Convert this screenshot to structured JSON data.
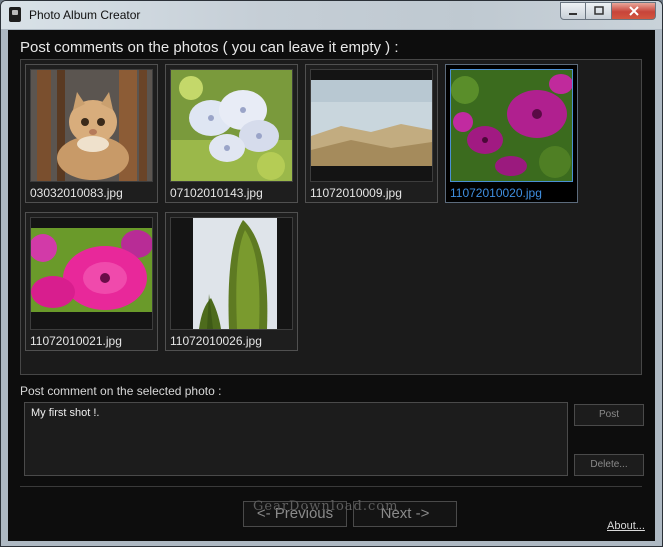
{
  "window": {
    "title": "Photo Album Creator",
    "icon": "camera-icon",
    "controls": {
      "minimize": "minimize-icon",
      "maximize": "maximize-icon",
      "close": "close-icon"
    }
  },
  "header": "Post comments on the photos ( you can leave it empty ) :",
  "photos": [
    {
      "filename": "03032010083.jpg",
      "thumbnail": "kitten",
      "selected": false
    },
    {
      "filename": "07102010143.jpg",
      "thumbnail": "white-flowers",
      "selected": false
    },
    {
      "filename": "11072010009.jpg",
      "thumbnail": "landscape",
      "selected": false
    },
    {
      "filename": "11072010020.jpg",
      "thumbnail": "purple-petunias",
      "selected": true
    },
    {
      "filename": "11072010021.jpg",
      "thumbnail": "pink-petunia",
      "selected": false
    },
    {
      "filename": "11072010026.jpg",
      "thumbnail": "cypress-tree",
      "selected": false
    }
  ],
  "comment": {
    "label": "Post comment on the selected photo :",
    "value": "My first shot !."
  },
  "buttons": {
    "post": "Post",
    "delete": "Delete...",
    "previous": "<- Previous",
    "next": "Next ->",
    "about": "About..."
  },
  "watermark": "GearDownload.com",
  "colors": {
    "background": "#0d0d0d",
    "panel": "#1b1b1b",
    "selection_accent": "#3f8fe0",
    "text": "#e8e8e8",
    "disabled_text": "#8a8a8a"
  }
}
